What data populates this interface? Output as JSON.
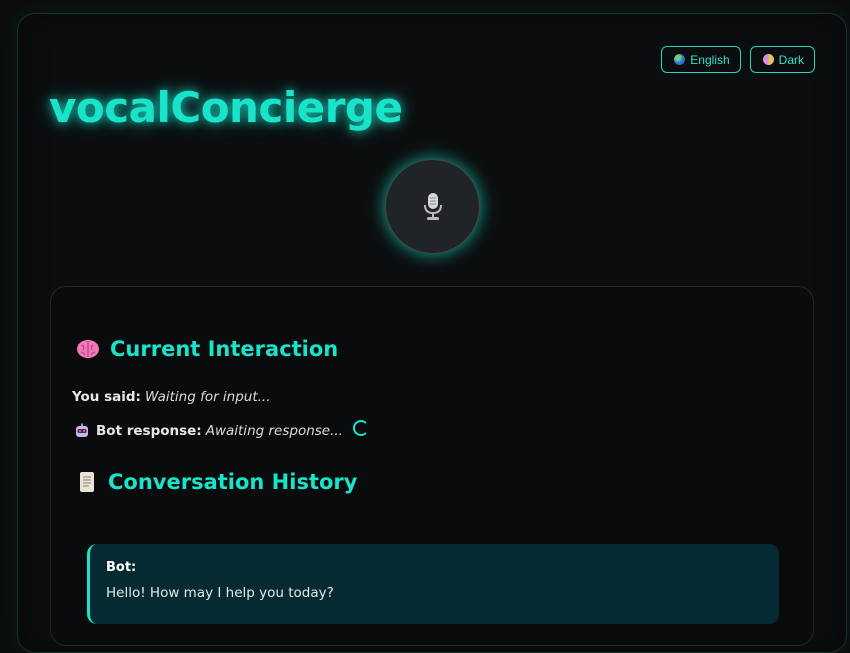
{
  "app": {
    "title": "vocalConcierge"
  },
  "controls": {
    "language_label": "English",
    "theme_label": "Dark"
  },
  "mic": {
    "icon": "microphone-icon"
  },
  "current": {
    "heading": "Current Interaction",
    "heading_icon": "brain-icon",
    "you_said_label": "You said:",
    "you_said_value": "Waiting for input...",
    "bot_icon": "robot-icon",
    "bot_label": "Bot response:",
    "bot_value": "Awaiting response..."
  },
  "history": {
    "heading": "Conversation History",
    "heading_icon": "scroll-icon",
    "items": [
      {
        "sender": "Bot:",
        "text": "Hello! How may I help you today?"
      }
    ]
  },
  "colors": {
    "accent": "#19e3c9",
    "background": "#0b0c0e",
    "history_bubble": "#062a31"
  }
}
